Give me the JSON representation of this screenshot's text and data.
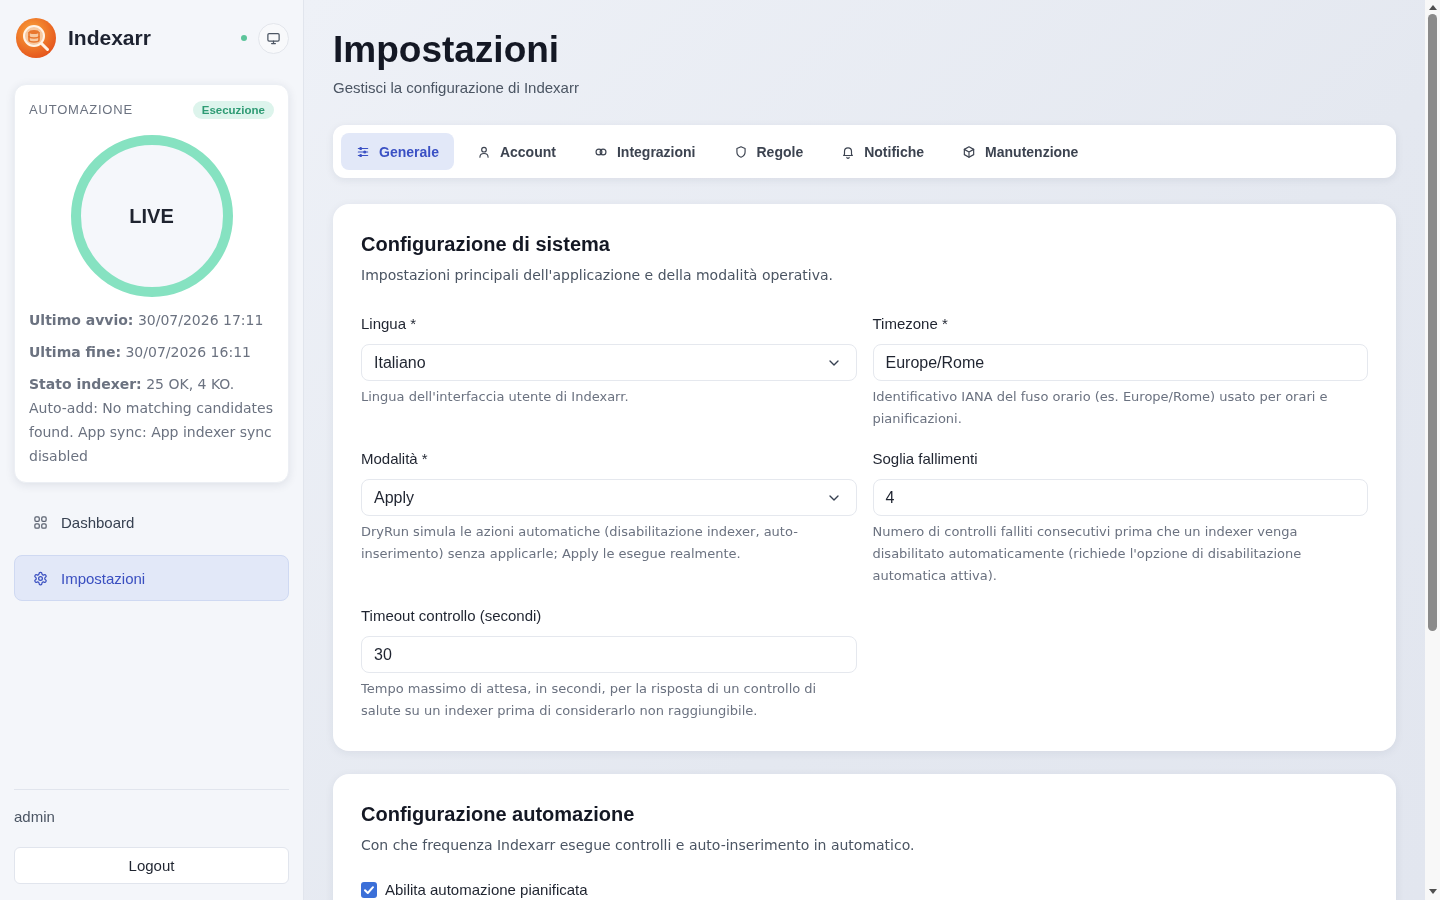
{
  "sidebar": {
    "brand": "Indexarr",
    "online": true,
    "automation": {
      "title": "AUTOMAZIONE",
      "badge": "Esecuzione",
      "running": true,
      "ring_label": "LIVE",
      "details": [
        "**Ultimo avvio:** 30/07/2026 17:11",
        "**Ultima fine:** 30/07/2026 16:11",
        "**Stato indexer:** 25 OK, 4 KO. Auto-add: No matching candidates found. App sync: App indexer sync disabled"
      ]
    },
    "nav": [
      {
        "label": "Dashboard",
        "selected": false
      },
      {
        "label": "Impostazioni",
        "selected": true
      }
    ],
    "user": "admin",
    "logout_button": "Logout"
  },
  "page": {
    "title": "Impostazioni",
    "subtitle": "Gestisci la configurazione di Indexarr"
  },
  "tabs": [
    {
      "label": "Generale",
      "selected": true
    },
    {
      "label": "Account",
      "selected": false
    },
    {
      "label": "Integrazioni",
      "selected": false
    },
    {
      "label": "Regole",
      "selected": false
    },
    {
      "label": "Notifiche",
      "selected": false
    },
    {
      "label": "Manutenzione",
      "selected": false
    }
  ],
  "sections": [
    {
      "title": "Configurazione di sistema",
      "description": "Impostazioni principali dell'applicazione e della modalità operativa.",
      "fields": [
        {
          "kind": "select",
          "label": "Lingua *",
          "value": "Italiano",
          "help": "Lingua dell'interfaccia utente di Indexarr."
        },
        {
          "kind": "input",
          "label": "Timezone *",
          "value": "Europe/Rome",
          "help": "Identificativo IANA del fuso orario (es. Europe/Rome) usato per orari e pianificazioni."
        },
        {
          "kind": "select",
          "label": "Modalità *",
          "value": "Apply",
          "help": "DryRun simula le azioni automatiche (disabilitazione indexer, auto-inserimento) senza applicarle; Apply le esegue realmente."
        },
        {
          "kind": "input",
          "label": "Soglia fallimenti",
          "value": "4",
          "help": "Numero di controlli falliti consecutivi prima che un indexer venga disabilitato automaticamente (richiede l'opzione di disabilitazione automatica attiva)."
        },
        {
          "kind": "input",
          "label": "Timeout controllo (secondi)",
          "value": "30",
          "help": "Tempo massimo di attesa, in secondi, per la risposta di un controllo di salute su un indexer prima di considerarlo non raggiungibile."
        }
      ]
    },
    {
      "title": "Configurazione automazione",
      "description": "Con che frequenza Indexarr esegue controlli e auto-inserimento in automatico.",
      "fields": [
        {
          "kind": "checkbox",
          "label": "Abilita automazione pianificata",
          "checked": true
        }
      ]
    }
  ]
}
